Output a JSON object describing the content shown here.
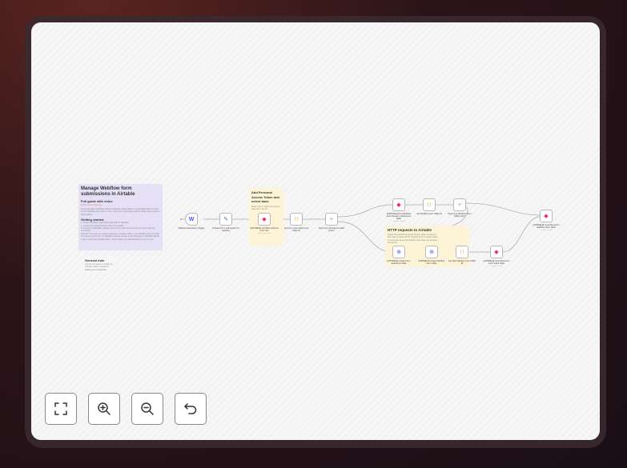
{
  "sticky_main": {
    "title": "Manage Webflow form submissions in Airtable",
    "subtitle": "Full guide with video",
    "link": "Check out the video here",
    "intro": "This automation workflow will automatically create tables in an Airtable base for each of your Webflow form forms. Then, every form submission will be added as a record in those tables.",
    "gs_title": "Getting started",
    "steps": [
      "1. Create Webflow credentials using API in Webflow",
      "2. Create a Personal Access Token for Airtable",
      "3. Connect credentials, update each of the nodes to ensure the correct creds are connected",
      "Tested? Once you are ready to add your contacts make it your Webflow forms to data.",
      "The name of your form in Webflow settings section of the Designer in Webflow will be used to name the Airtable tables. Those tables are automatically by this for you."
    ]
  },
  "sticky_note": {
    "title": "General note",
    "body": "You do not need to modify any of these nodes, except for adding your credentials."
  },
  "sticky_token": {
    "title": "Add Personal Access Token and select base",
    "body": "Make sure to select the correct base from the list."
  },
  "sticky_http": {
    "title": "HTTP requests to Airtable",
    "body": "Select the Airtable Personal Access Token credential. We need to make HTTP requests here to create tables in your base since the Airtable node does not yet have this option."
  },
  "nodes": [
    {
      "id": "n1",
      "label": "Webflow Submission Trigger",
      "sub": "",
      "icon": "webflow-icon",
      "glyph": "W",
      "color": "#4353ff"
    },
    {
      "id": "n2",
      "label": "Prepare Form submission for workflow",
      "sub": "",
      "icon": "edit-icon",
      "glyph": "✎",
      "color": "#3a78c6"
    },
    {
      "id": "n3",
      "label": "[AIRTABLE] Get Base Schema From Set",
      "sub": "getSchema: base",
      "icon": "airtable-icon",
      "glyph": "◆",
      "color": "#f82b60"
    },
    {
      "id": "n4",
      "label": "Set Form Index Reference Table ID",
      "sub": "",
      "icon": "code-icon",
      "glyph": "{ }",
      "color": "#f0a020"
    },
    {
      "id": "n5",
      "label": "Does Form Reference Table Exist?",
      "sub": "",
      "icon": "if-icon",
      "glyph": "⑂",
      "color": "#2f8a5a"
    },
    {
      "id": "n6",
      "label": "[AIRTABLE] Find Webflow Form Record in Reference Table",
      "sub": "search: record",
      "icon": "airtable-icon",
      "glyph": "◆",
      "color": "#f82b60"
    },
    {
      "id": "n7",
      "label": "Get Webflow Form Table ID",
      "sub": "",
      "icon": "code-icon",
      "glyph": "{ }",
      "color": "#f0a020"
    },
    {
      "id": "n8",
      "label": "Does Your Webflow Form Table exist?",
      "sub": "",
      "icon": "if-icon",
      "glyph": "⑂",
      "color": "#2f8a5a"
    },
    {
      "id": "n9",
      "label": "[AIRTABLE] Insert Record to Webflow Form Table",
      "sub": "create: record",
      "icon": "airtable-icon",
      "glyph": "◆",
      "color": "#f82b60"
    },
    {
      "id": "n10",
      "label": "[AIRTABLE] Create Form Reference Table",
      "sub": "",
      "icon": "globe-icon",
      "glyph": "⊕",
      "color": "#5a60e8"
    },
    {
      "id": "n11",
      "label": "[AIRTABLE] Create Webflow Form Table",
      "sub": "",
      "icon": "globe-icon",
      "glyph": "⊕",
      "color": "#5a60e8"
    },
    {
      "id": "n12",
      "label": "Get New Webflow Form Table ID",
      "sub": "",
      "icon": "code-icon",
      "glyph": "{ }",
      "color": "#f0a020"
    },
    {
      "id": "n13",
      "label": "[AIRTABLE] Insert Record to Form Index Table",
      "sub": "create: record",
      "icon": "airtable-icon",
      "glyph": "◆",
      "color": "#f82b60"
    }
  ],
  "controls": {
    "fit_label": "Fit view",
    "zoom_in_label": "Zoom in",
    "zoom_out_label": "Zoom out",
    "undo_label": "Reset zoom"
  }
}
